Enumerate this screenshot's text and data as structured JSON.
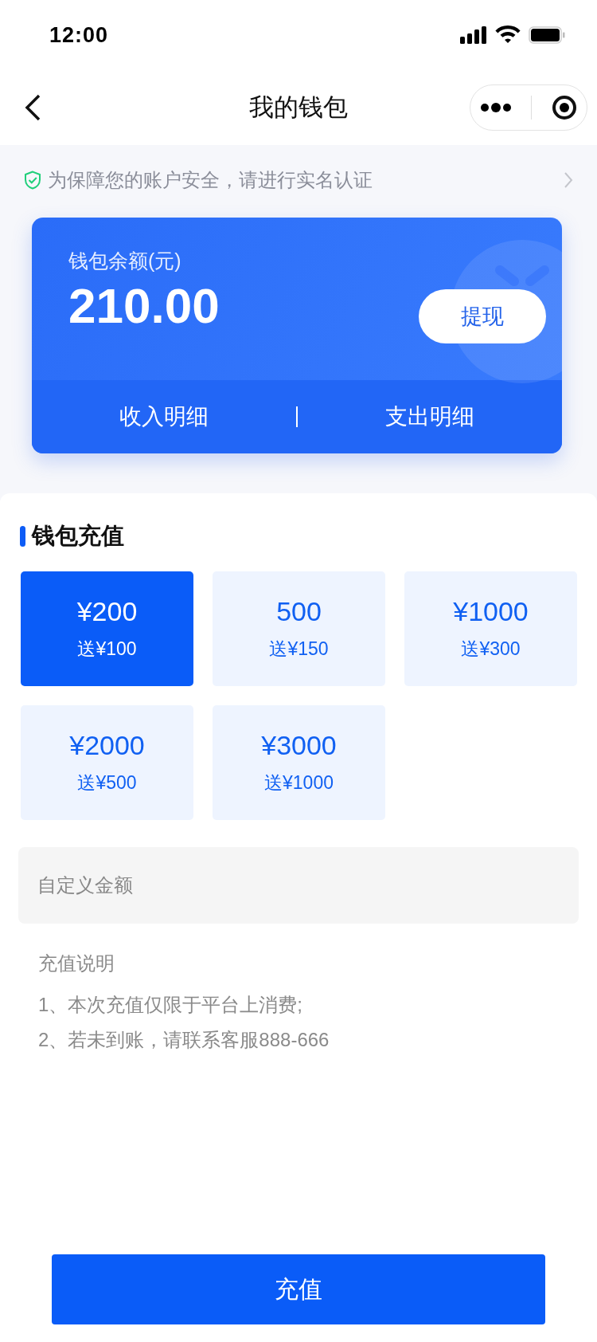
{
  "status_bar": {
    "time": "12:00"
  },
  "nav": {
    "title": "我的钱包"
  },
  "notice": {
    "text": "为保障您的账户安全，请进行实名认证"
  },
  "wallet": {
    "label": "钱包余额(元)",
    "balance": "210.00",
    "withdraw_button": "提现",
    "links": [
      "收入明细",
      "支出明细"
    ]
  },
  "recharge": {
    "title": "钱包充值",
    "options": [
      {
        "amount": "¥200",
        "bonus": "送¥100",
        "selected": true
      },
      {
        "amount": "500",
        "bonus": "送¥150",
        "selected": false
      },
      {
        "amount": "¥1000",
        "bonus": "送¥300",
        "selected": false
      },
      {
        "amount": "¥2000",
        "bonus": "送¥500",
        "selected": false
      },
      {
        "amount": "¥3000",
        "bonus": "送¥1000",
        "selected": false
      }
    ],
    "custom_amount": {
      "placeholder": "自定义金额"
    },
    "notes_title": "充值说明",
    "notes": [
      "1、本次充值仅限于平台上消费;",
      "2、若未到账，请联系客服888-666"
    ]
  },
  "submit_button": "充值"
}
